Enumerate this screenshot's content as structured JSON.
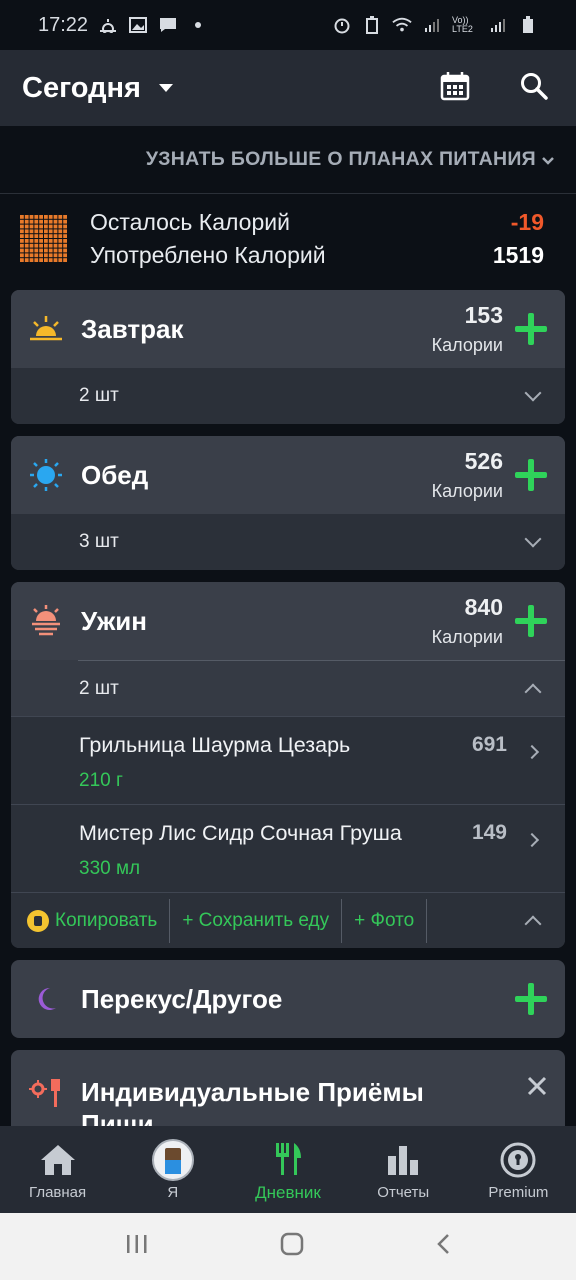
{
  "status_bar": {
    "time": "17:22",
    "network": "Vo)) LTE2"
  },
  "app_bar": {
    "title": "Сегодня"
  },
  "plan_link": {
    "label": "УЗНАТЬ БОЛЬШЕ О ПЛАНАХ ПИТАНИЯ"
  },
  "summary": {
    "remaining_label": "Осталось Калорий",
    "remaining_value": "-19",
    "consumed_label": "Употреблено Калорий",
    "consumed_value": "1519"
  },
  "meals": [
    {
      "name": "Завтрак",
      "calories": "153",
      "unit": "Калории",
      "count": "2 шт"
    },
    {
      "name": "Обед",
      "calories": "526",
      "unit": "Калории",
      "count": "3 шт"
    },
    {
      "name": "Ужин",
      "calories": "840",
      "unit": "Калории",
      "count": "2 шт",
      "items": [
        {
          "name": "Грильница  Шаурма Цезарь",
          "qty": "210 г",
          "calories": "691"
        },
        {
          "name": "Мистер Лис Сидр Сочная Груша",
          "qty": "330 мл",
          "calories": "149"
        }
      ],
      "actions": {
        "copy": "Копировать",
        "save": "+ Сохранить еду",
        "photo": "+ Фото"
      }
    },
    {
      "name": "Перекус/Другое"
    },
    {
      "name": "Индивидуальные Приёмы Пищи"
    }
  ],
  "bottom_nav": [
    {
      "label": "Главная"
    },
    {
      "label": "Я"
    },
    {
      "label": "Дневник"
    },
    {
      "label": "Отчеты"
    },
    {
      "label": "Premium"
    }
  ],
  "colors": {
    "accent": "#34c759",
    "negative": "#f0582a",
    "card": "#353a44",
    "background": "#0c1016"
  }
}
